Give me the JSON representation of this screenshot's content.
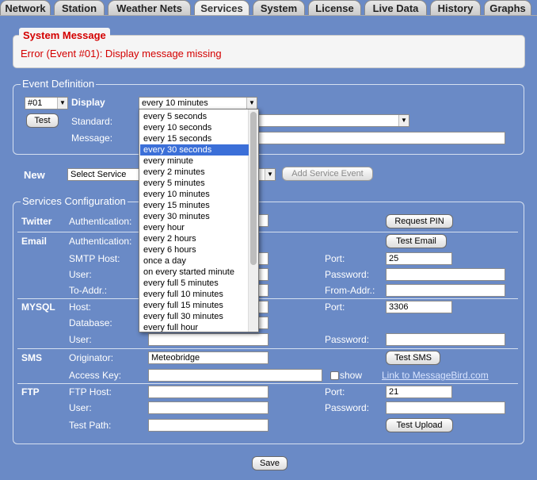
{
  "tabs": [
    "Network",
    "Station",
    "Weather Nets",
    "Services",
    "System",
    "License",
    "Live Data",
    "History",
    "Graphs"
  ],
  "active_tab": "Services",
  "system_message": {
    "title": "System Message",
    "text": "Error (Event #01): Display message missing"
  },
  "event_definition": {
    "legend": "Event Definition",
    "event_number": "#01",
    "display_label": "Display",
    "interval_value": "every 10 minutes",
    "test_button": "Test",
    "standard_label": "Standard:",
    "message_label": "Message:",
    "message_value": "",
    "interval_options": [
      "every 5 seconds",
      "every 10 seconds",
      "every 15 seconds",
      "every 30 seconds",
      "every minute",
      "every 2 minutes",
      "every 5 minutes",
      "every 10 minutes",
      "every 15 minutes",
      "every 30 minutes",
      "every hour",
      "every 2 hours",
      "every 6 hours",
      "once a day",
      "on every started minute",
      "every full 5 minutes",
      "every full 10 minutes",
      "every full 15 minutes",
      "every full 30 minutes",
      "every full hour"
    ],
    "highlighted_option": "every 30 seconds"
  },
  "new_service": {
    "label": "New",
    "select_value": "Select Service",
    "add_button": "Add Service Event"
  },
  "services": {
    "legend": "Services Configuration",
    "twitter": {
      "title": "Twitter",
      "auth_label": "Authentication:",
      "request_pin_button": "Request PIN"
    },
    "email": {
      "title": "Email",
      "auth_label": "Authentication:",
      "test_button": "Test Email",
      "smtp_label": "SMTP Host:",
      "port_label": "Port:",
      "port_value": "25",
      "user_label": "User:",
      "password_label": "Password:",
      "to_label": "To-Addr.:",
      "from_label": "From-Addr.:"
    },
    "mysql": {
      "title": "MYSQL",
      "host_label": "Host:",
      "port_label": "Port:",
      "port_value": "3306",
      "database_label": "Database:",
      "user_label": "User:",
      "password_label": "Password:"
    },
    "sms": {
      "title": "SMS",
      "originator_label": "Originator:",
      "originator_value": "Meteobridge",
      "test_button": "Test SMS",
      "access_key_label": "Access Key:",
      "show_label": "show",
      "link_text": "Link to MessageBird.com"
    },
    "ftp": {
      "title": "FTP",
      "host_label": "FTP Host:",
      "port_label": "Port:",
      "port_value": "21",
      "user_label": "User:",
      "password_label": "Password:",
      "path_label": "Test Path:",
      "test_button": "Test Upload"
    }
  },
  "save_button": "Save",
  "colors": {
    "background": "#6a8ac6",
    "error": "#d40000",
    "highlight": "#3b6fd8"
  }
}
